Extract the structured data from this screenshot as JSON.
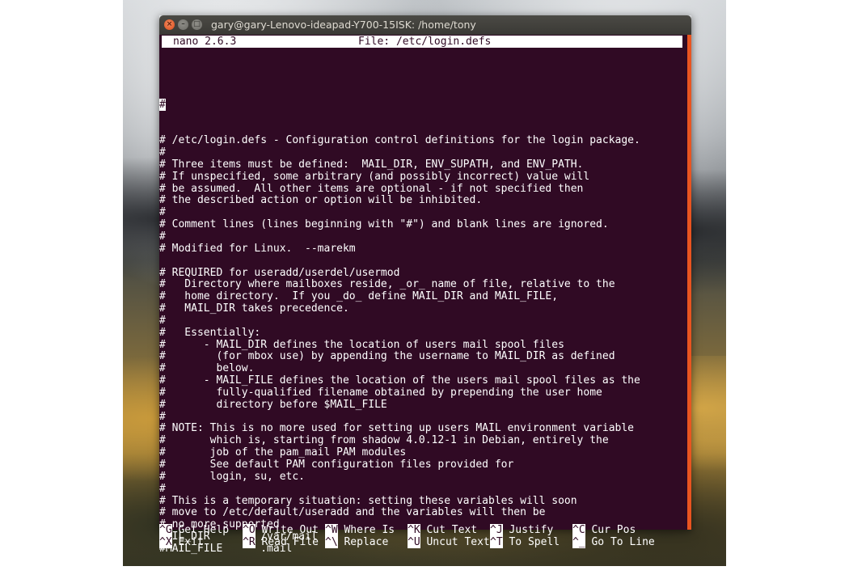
{
  "window": {
    "title": "gary@gary-Lenovo-ideapad-Y700-15ISK: /home/tony",
    "close_glyph": "×",
    "min_glyph": "–",
    "max_glyph": "□"
  },
  "nano": {
    "version": "nano 2.6.3",
    "file_label": "File: /etc/login.defs"
  },
  "file_lines": [
    "# /etc/login.defs - Configuration control definitions for the login package.",
    "#",
    "# Three items must be defined:  MAIL_DIR, ENV_SUPATH, and ENV_PATH.",
    "# If unspecified, some arbitrary (and possibly incorrect) value will",
    "# be assumed.  All other items are optional - if not specified then",
    "# the described action or option will be inhibited.",
    "#",
    "# Comment lines (lines beginning with \"#\") and blank lines are ignored.",
    "#",
    "# Modified for Linux.  --marekm",
    "",
    "# REQUIRED for useradd/userdel/usermod",
    "#   Directory where mailboxes reside, _or_ name of file, relative to the",
    "#   home directory.  If you _do_ define MAIL_DIR and MAIL_FILE,",
    "#   MAIL_DIR takes precedence.",
    "#",
    "#   Essentially:",
    "#      - MAIL_DIR defines the location of users mail spool files",
    "#        (for mbox use) by appending the username to MAIL_DIR as defined",
    "#        below.",
    "#      - MAIL_FILE defines the location of the users mail spool files as the",
    "#        fully-qualified filename obtained by prepending the user home",
    "#        directory before $MAIL_FILE",
    "#",
    "# NOTE: This is no more used for setting up users MAIL environment variable",
    "#       which is, starting from shadow 4.0.12-1 in Debian, entirely the",
    "#       job of the pam_mail PAM modules",
    "#       See default PAM configuration files provided for",
    "#       login, su, etc.",
    "#",
    "# This is a temporary situation: setting these variables will soon",
    "# move to /etc/default/useradd and the variables will then be",
    "# no more supported",
    "MAIL_DIR        /var/mail",
    "#MAIL_FILE      .mail"
  ],
  "cursor_line": "#",
  "shortcuts": [
    {
      "key": "^G",
      "label": " Get Help"
    },
    {
      "key": "^O",
      "label": " Write Out"
    },
    {
      "key": "^W",
      "label": " Where Is"
    },
    {
      "key": "^K",
      "label": " Cut Text"
    },
    {
      "key": "^J",
      "label": " Justify"
    },
    {
      "key": "^C",
      "label": " Cur Pos"
    },
    {
      "key": "^X",
      "label": " Exit"
    },
    {
      "key": "^R",
      "label": " Read File"
    },
    {
      "key": "^\\",
      "label": " Replace"
    },
    {
      "key": "^U",
      "label": " Uncut Text"
    },
    {
      "key": "^T",
      "label": " To Spell"
    },
    {
      "key": "^_",
      "label": " Go To Line"
    }
  ],
  "colors": {
    "terminal_bg": "#300a24",
    "scrollbar": "#e95420",
    "titlebar": "#3c3b37"
  }
}
